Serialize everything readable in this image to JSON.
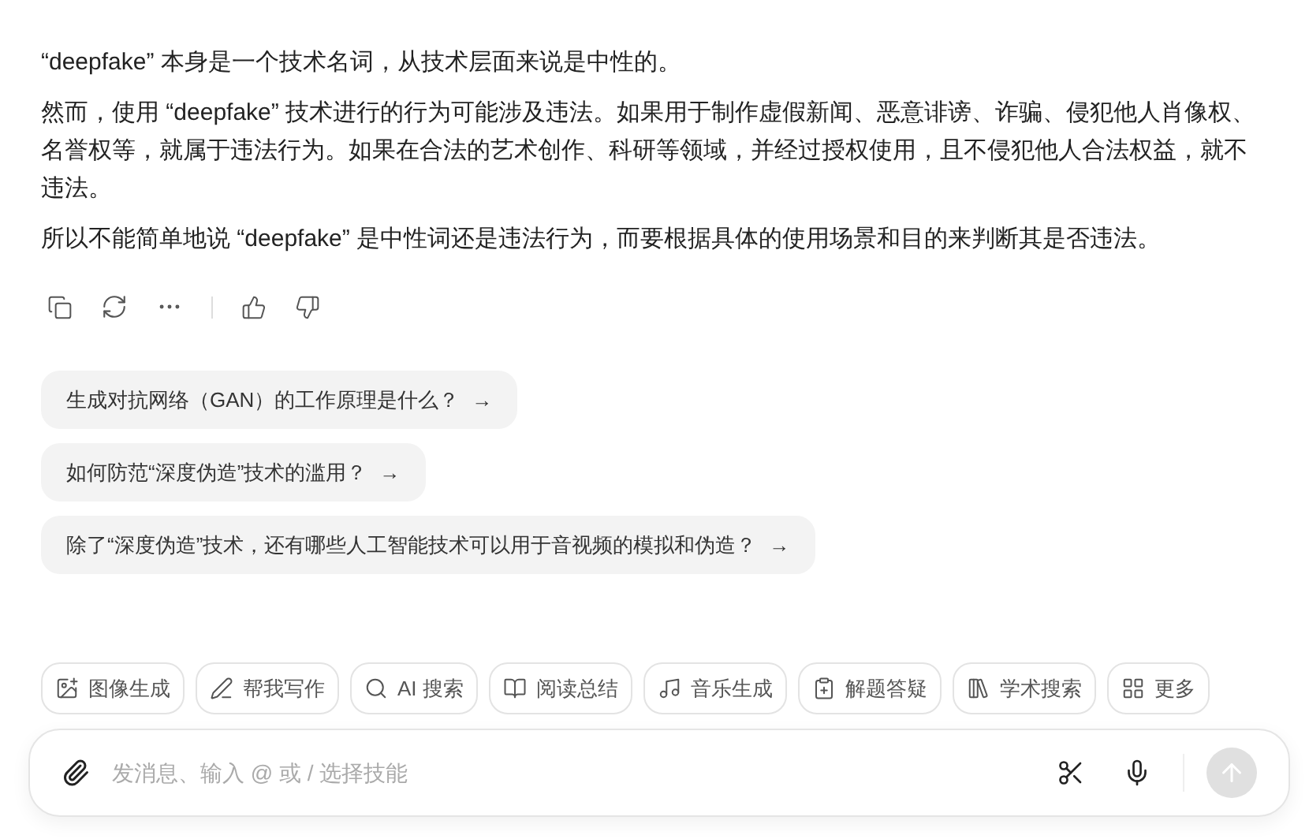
{
  "answer": {
    "paragraphs": [
      "“deepfake” 本身是一个技术名词，从技术层面来说是中性的。",
      "然而，使用 “deepfake” 技术进行的行为可能涉及违法。如果用于制作虚假新闻、恶意诽谤、诈骗、侵犯他人肖像权、名誉权等，就属于违法行为。如果在合法的艺术创作、科研等领域，并经过授权使用，且不侵犯他人合法权益，就不违法。",
      "所以不能简单地说 “deepfake” 是中性词还是违法行为，而要根据具体的使用场景和目的来判断其是否违法。"
    ]
  },
  "suggestions": [
    {
      "text": "生成对抗网络（GAN）的工作原理是什么？",
      "arrow": "→"
    },
    {
      "text": "如何防范“深度伪造”技术的滥用？",
      "arrow": "→"
    },
    {
      "text": "除了“深度伪造”技术，还有哪些人工智能技术可以用于音视频的模拟和伪造？",
      "arrow": "→"
    }
  ],
  "skills": [
    "图像生成",
    "帮我写作",
    "AI 搜索",
    "阅读总结",
    "音乐生成",
    "解题答疑",
    "学术搜索",
    "更多"
  ],
  "composer": {
    "placeholder": "发消息、输入 @ 或 / 选择技能",
    "send_disabled": true
  }
}
